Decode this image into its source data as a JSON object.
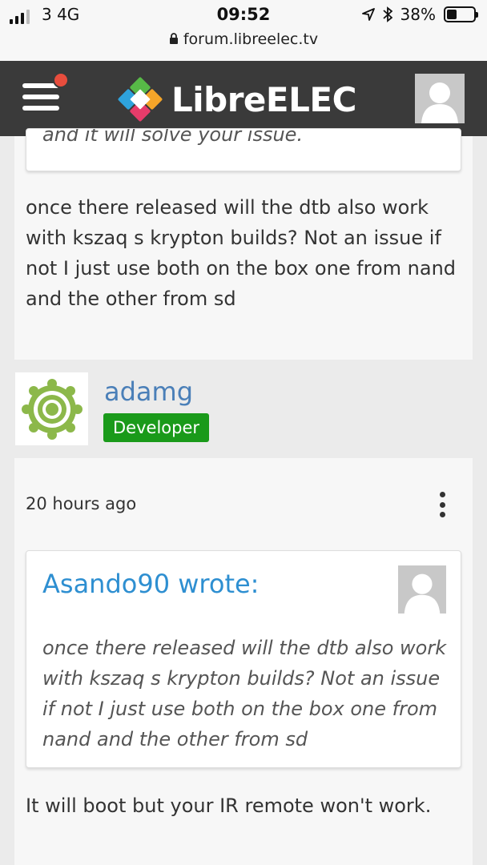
{
  "status_bar": {
    "carrier": "3  4G",
    "time": "09:52",
    "battery": "38%",
    "battery_level": 0.38,
    "url": "forum.libreelec.tv"
  },
  "header": {
    "brand": "LibreELEC",
    "colors": {
      "background": "#3a3a3a",
      "notification": "#e84d3d"
    }
  },
  "previous_post": {
    "quote_tail": "and it will solve your issue.",
    "body": "once there released will the dtb also work with kszaq s krypton builds? Not an issue if not I just use both on the box one from nand and the other from sd"
  },
  "post": {
    "author": "adamg",
    "badge": "Developer",
    "badge_color": "#1a9a1a",
    "timestamp": "20 hours ago",
    "quote": {
      "header": "Asando90 wrote:",
      "body": "once there released will the dtb also work with kszaq s krypton builds? Not an issue if not I just use both on the box one from nand and the other from sd"
    },
    "body": "It will boot but your IR remote won't work."
  }
}
